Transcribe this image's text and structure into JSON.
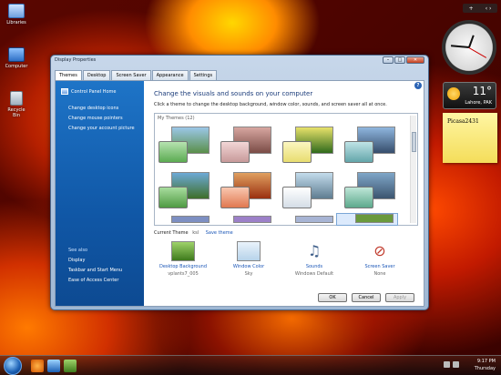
{
  "desktop": {
    "icons": [
      {
        "label": "Libraries"
      },
      {
        "label": "Computer"
      },
      {
        "label": "Recycle Bin"
      }
    ]
  },
  "gadgets": {
    "weather": {
      "temp": "11°",
      "location": "Lahore, PAK"
    },
    "note": {
      "text": "Picasa2431"
    },
    "controls": {
      "plus": "+",
      "nav": "‹ ›"
    }
  },
  "window": {
    "title": "Display Properties",
    "tabs": [
      "Themes",
      "Desktop",
      "Screen Saver",
      "Appearance",
      "Settings"
    ],
    "sidebar": {
      "home": "Control Panel Home",
      "links": [
        "Change desktop icons",
        "Change mouse pointers",
        "Change your account picture"
      ],
      "see_also_header": "See also",
      "see_also": [
        "Display",
        "Taskbar and Start Menu",
        "Ease of Access Center"
      ]
    },
    "headline": "Change the visuals and sounds on your computer",
    "instruction": "Click a theme to change the desktop background, window color, sounds, and screen saver all at once.",
    "theme_group": "My Themes (12)",
    "current_theme_label": "Current Theme",
    "current_theme_value": "ksl",
    "save_theme": "Save theme",
    "options": [
      {
        "title": "Desktop Background",
        "sub": "vplants7_005"
      },
      {
        "title": "Window Color",
        "sub": "Sky"
      },
      {
        "title": "Sounds",
        "sub": "Windows Default"
      },
      {
        "title": "Screen Saver",
        "sub": "None"
      }
    ],
    "buttons": {
      "ok": "OK",
      "cancel": "Cancel",
      "apply": "Apply"
    }
  },
  "taskbar": {
    "time": "9:17 PM",
    "day": "Thursday"
  },
  "colors": {
    "sidebar": "#1a67b8",
    "link": "#1a56b7"
  }
}
